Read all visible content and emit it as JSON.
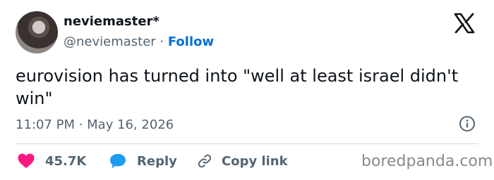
{
  "author": {
    "display_name": "neviemaster*",
    "handle": "@neviemaster",
    "separator": " · ",
    "follow_label": "Follow"
  },
  "tweet": {
    "text": "eurovision has turned into \"well at least israel didn't win\"",
    "timestamp": "11:07 PM · May 16, 2026"
  },
  "actions": {
    "likes_count": "45.7K",
    "reply_label": "Reply",
    "copy_link_label": "Copy link"
  },
  "icons": {
    "brand": "x-logo-icon",
    "info": "info-icon",
    "like": "heart-icon",
    "reply": "reply-bubble-icon",
    "copy": "link-icon"
  },
  "colors": {
    "like": "#f91880",
    "reply": "#1d9bf0",
    "follow": "#006fd6",
    "muted": "#536471"
  },
  "watermark": "boredpanda.com"
}
